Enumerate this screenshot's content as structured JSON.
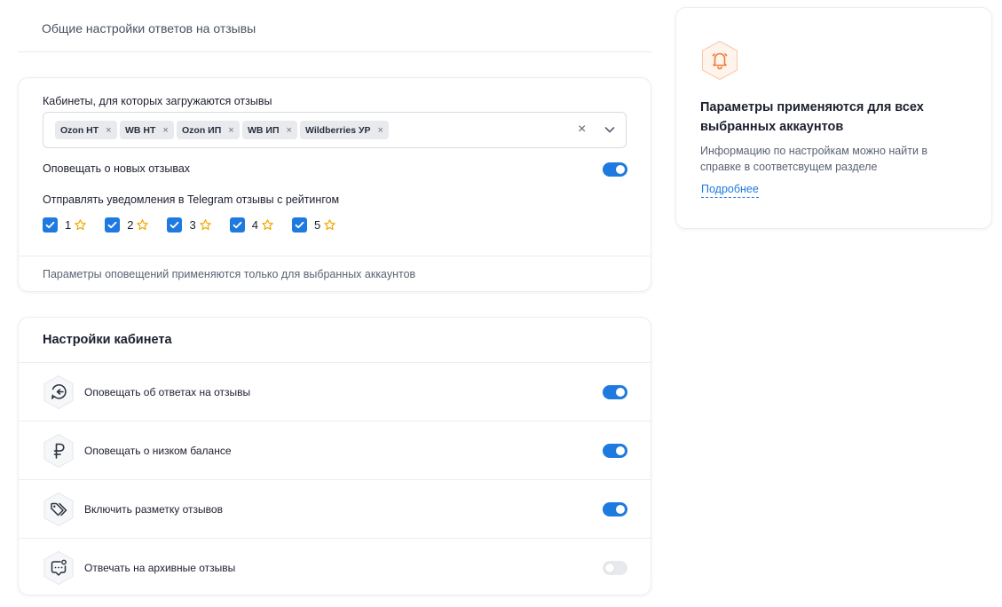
{
  "section": {
    "title": "Общие настройки ответов на отзывы"
  },
  "general": {
    "cabinets_label": "Кабинеты, для которых загружаются отзывы",
    "chips": [
      {
        "label": "Ozon НТ"
      },
      {
        "label": "WB НТ"
      },
      {
        "label": "Ozon ИП"
      },
      {
        "label": "WB ИП"
      },
      {
        "label": "Wildberries УР"
      }
    ],
    "chip_remove": "×",
    "clear_all": "×",
    "notify_new_label": "Оповещать о новых отзывах",
    "notify_new_on": true,
    "telegram_label": "Отправлять уведомления в Telegram отзывы с рейтингом",
    "ratings": [
      {
        "value": "1",
        "checked": true
      },
      {
        "value": "2",
        "checked": true
      },
      {
        "value": "3",
        "checked": true
      },
      {
        "value": "4",
        "checked": true
      },
      {
        "value": "5",
        "checked": true
      }
    ],
    "footer_note": "Параметры оповещений применяются только для выбранных аккаунтов"
  },
  "cabinet": {
    "title": "Настройки кабинета",
    "settings": [
      {
        "label": "Оповещать об ответах на отзывы",
        "icon": "reply-chat-icon",
        "on": true
      },
      {
        "label": "Оповещать о низком балансе",
        "icon": "ruble-icon",
        "on": true
      },
      {
        "label": "Включить разметку отзывов",
        "icon": "tags-icon",
        "on": true
      },
      {
        "label": "Отвечать на архивные отзывы",
        "icon": "chat-badge-icon",
        "on": false
      }
    ]
  },
  "info": {
    "icon": "bell-icon",
    "title": "Параметры применяются для всех выбранных аккаунтов",
    "text": "Информацию по настройкам можно найти в справке в соответсвущем разделе",
    "link": "Подробнее"
  },
  "colors": {
    "accent": "#1f7ae0",
    "star": "#f2a900",
    "bell": "#f07a3a",
    "toggle_off": "#e7e9ee"
  }
}
